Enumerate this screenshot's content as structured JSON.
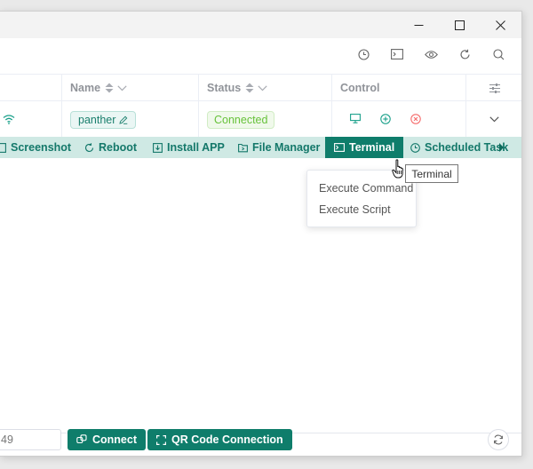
{
  "window": {
    "controls": [
      "minimize-icon",
      "maximize-icon",
      "close-icon"
    ]
  },
  "toolbar": {
    "icons": [
      "clock-icon",
      "terminal-icon",
      "eye-icon",
      "refresh-icon",
      "search-icon"
    ]
  },
  "table": {
    "columns": {
      "name": "Name",
      "status": "Status",
      "control": "Control"
    },
    "row": {
      "name_tag": "panther",
      "status": "Connected",
      "control_icons": [
        "monitor-icon",
        "plus-circle-icon",
        "close-circle-icon"
      ]
    }
  },
  "actions": {
    "screenshot": "Screenshot",
    "reboot": "Reboot",
    "install_app": "Install APP",
    "file_manager": "File Manager",
    "terminal": "Terminal",
    "scheduled_task": "Scheduled Task"
  },
  "dropdown": {
    "items": [
      "Execute Command",
      "Execute Script"
    ]
  },
  "tooltip": "Terminal",
  "footer": {
    "input_value": "49",
    "connect_label": "Connect",
    "qr_label": "QR Code Connection"
  },
  "colors": {
    "accent": "#0f7d6b",
    "action_bar_bg": "#cfe9e4",
    "status_green": "#67c23a"
  }
}
